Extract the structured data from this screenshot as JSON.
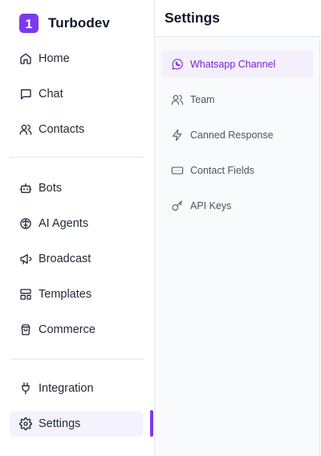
{
  "app": {
    "name": "Turbodev",
    "logo_text": "1"
  },
  "sidebar": {
    "items": [
      {
        "label": "Home",
        "icon": "home-icon"
      },
      {
        "label": "Chat",
        "icon": "chat-icon"
      },
      {
        "label": "Contacts",
        "icon": "contacts-icon"
      },
      {
        "label": "Bots",
        "icon": "bot-icon"
      },
      {
        "label": "AI Agents",
        "icon": "brain-icon"
      },
      {
        "label": "Broadcast",
        "icon": "megaphone-icon"
      },
      {
        "label": "Templates",
        "icon": "templates-icon"
      },
      {
        "label": "Commerce",
        "icon": "shopping-bag-icon"
      },
      {
        "label": "Integration",
        "icon": "plug-icon"
      },
      {
        "label": "Settings",
        "icon": "gear-icon",
        "active": true
      }
    ]
  },
  "settings_panel": {
    "title": "Settings",
    "items": [
      {
        "label": "Whatsapp Channel",
        "icon": "whatsapp-icon",
        "active": true
      },
      {
        "label": "Team",
        "icon": "team-icon"
      },
      {
        "label": "Canned Response",
        "icon": "lightning-icon"
      },
      {
        "label": "Contact Fields",
        "icon": "text-field-icon"
      },
      {
        "label": "API Keys",
        "icon": "key-icon"
      }
    ]
  },
  "colors": {
    "accent": "#7c3aed",
    "active_text": "#7e22ce",
    "active_bg": "#f3f0fc"
  }
}
